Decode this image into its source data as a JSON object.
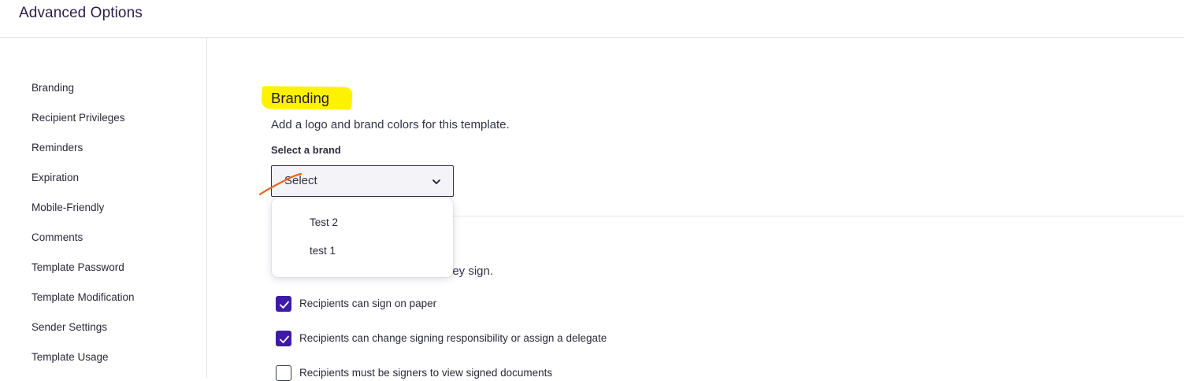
{
  "header": {
    "title": "Advanced Options"
  },
  "sidebar": {
    "items": [
      {
        "label": "Branding"
      },
      {
        "label": "Recipient Privileges"
      },
      {
        "label": "Reminders"
      },
      {
        "label": "Expiration"
      },
      {
        "label": "Mobile-Friendly"
      },
      {
        "label": "Comments"
      },
      {
        "label": "Template Password"
      },
      {
        "label": "Template Modification"
      },
      {
        "label": "Sender Settings"
      },
      {
        "label": "Template Usage"
      }
    ]
  },
  "branding": {
    "title": "Branding",
    "description": "Add a logo and brand colors for this template.",
    "select_label": "Select a brand",
    "select_value": "Select",
    "options": [
      {
        "label": "Test 2"
      },
      {
        "label": "test 1"
      }
    ]
  },
  "recipient_privileges": {
    "partial_description": "ney sign.",
    "checkboxes": [
      {
        "label": "Recipients can sign on paper",
        "checked": true
      },
      {
        "label": "Recipients can change signing responsibility or assign a delegate",
        "checked": true
      },
      {
        "label": "Recipients must be signers to view signed documents",
        "checked": false
      }
    ]
  },
  "colors": {
    "accent": "#3e1aa8",
    "highlight": "#fff200",
    "pen_mark": "#e8641e"
  }
}
